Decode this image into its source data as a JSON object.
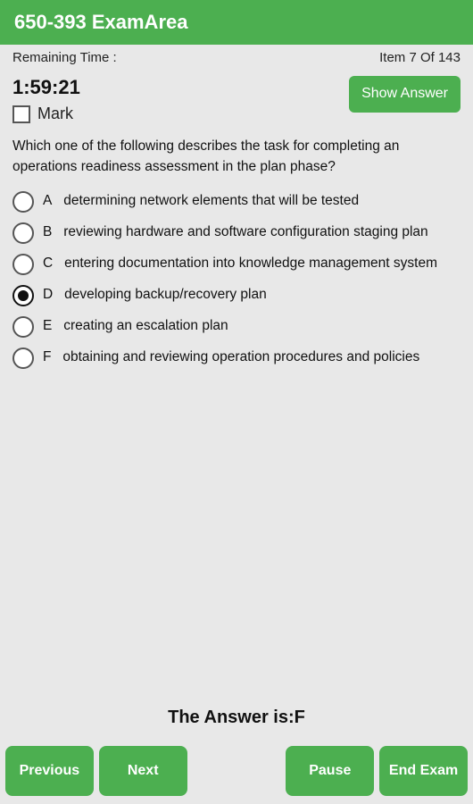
{
  "header": {
    "title": "650-393 ExamArea"
  },
  "info_bar": {
    "remaining_label": "Remaining Time :",
    "item_label": "Item 7 Of 143"
  },
  "timer": {
    "value": "1:59:21"
  },
  "mark": {
    "label": "Mark"
  },
  "show_answer_btn": "Show Answer",
  "question": {
    "text": "Which one of the following describes the task for completing an operations readiness assessment in the plan phase?"
  },
  "options": [
    {
      "id": "A",
      "text": "determining network elements that will be tested",
      "selected": false
    },
    {
      "id": "B",
      "text": "reviewing hardware and software configuration staging plan",
      "selected": false
    },
    {
      "id": "C",
      "text": "entering documentation into knowledge management system",
      "selected": false
    },
    {
      "id": "D",
      "text": "developing backup/recovery plan",
      "selected": true
    },
    {
      "id": "E",
      "text": "creating an escalation plan",
      "selected": false
    },
    {
      "id": "F",
      "text": "obtaining and reviewing operation procedures and policies",
      "selected": false
    }
  ],
  "answer": {
    "text": "The Answer is:F"
  },
  "footer": {
    "previous_label": "Previous",
    "next_label": "Next",
    "pause_label": "Pause",
    "end_exam_label": "End Exam"
  }
}
